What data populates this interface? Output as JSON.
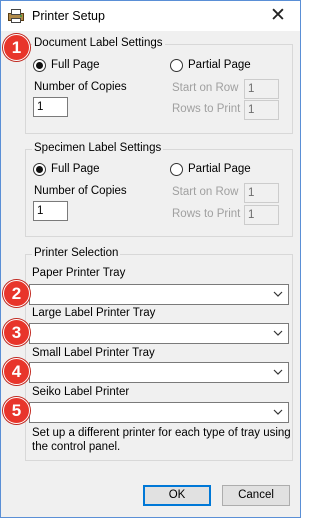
{
  "window": {
    "title": "Printer Setup",
    "close_glyph": "✕"
  },
  "document_labels": {
    "group_title": "Document Label Settings",
    "full_page": "Full Page",
    "partial_page": "Partial Page",
    "selected": "Full Page",
    "copies_label": "Number of Copies",
    "copies_value": "1",
    "start_on_row_label": "Start on Row",
    "start_on_row_value": "1",
    "rows_to_print_label": "Rows to Print",
    "rows_to_print_value": "1"
  },
  "specimen_labels": {
    "group_title": "Specimen Label Settings",
    "full_page": "Full Page",
    "partial_page": "Partial Page",
    "selected": "Full Page",
    "copies_label": "Number of Copies",
    "copies_value": "1",
    "start_on_row_label": "Start on Row",
    "start_on_row_value": "1",
    "rows_to_print_label": "Rows to Print",
    "rows_to_print_value": "1"
  },
  "printer_selection": {
    "group_title": "Printer Selection",
    "paper_tray_label": "Paper Printer Tray",
    "paper_tray_value": "",
    "large_label_tray_label": "Large Label Printer Tray",
    "large_label_tray_value": "",
    "small_label_tray_label": "Small Label Printer Tray",
    "small_label_tray_value": "",
    "seiko_label": "Seiko Label Printer",
    "seiko_value": "",
    "help_text_line1": "Set up a different printer for each type of tray using",
    "help_text_line2": "the control panel."
  },
  "buttons": {
    "ok": "OK",
    "cancel": "Cancel"
  },
  "badges": [
    "1",
    "2",
    "3",
    "4",
    "5"
  ],
  "colors": {
    "badge_red": "#e8352b",
    "window_border": "#5a8fd6",
    "default_button_border": "#0078d7"
  },
  "icons": {
    "app": "printer-app-icon",
    "close": "close-icon",
    "dropdown": "chevron-down-icon"
  }
}
